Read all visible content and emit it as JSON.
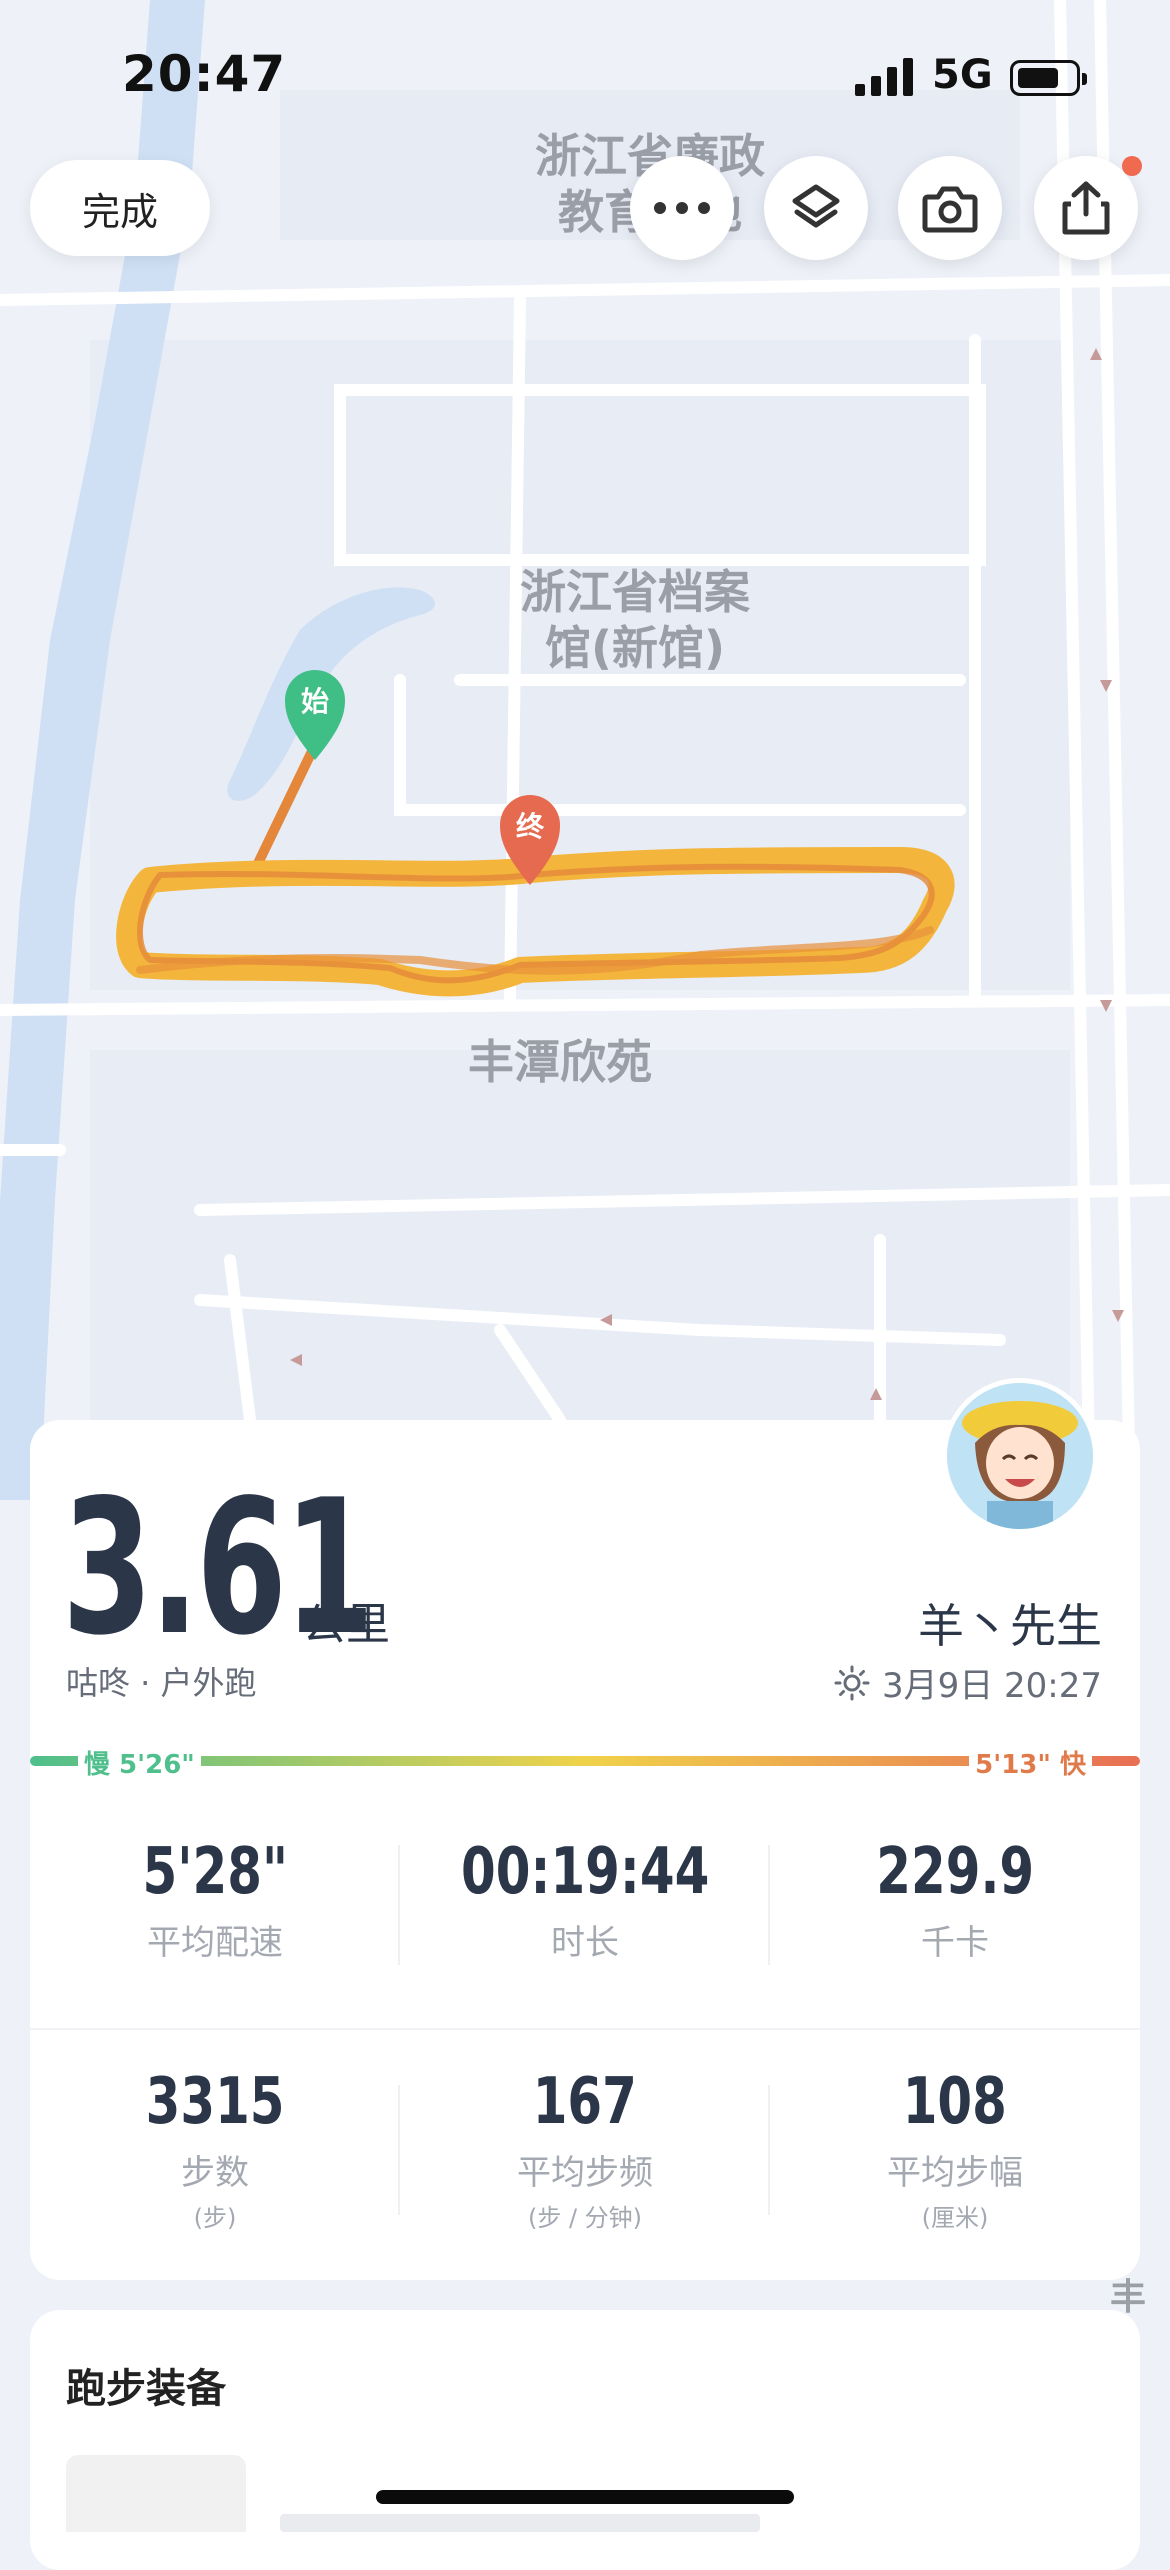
{
  "status_bar": {
    "time": "20:47",
    "network": "5G"
  },
  "top_bar": {
    "done_label": "完成"
  },
  "map": {
    "labels": [
      "浙江省廉政\n教育基地",
      "浙江省档案\n馆(新馆)",
      "丰潭欣苑"
    ],
    "edge_label": "丰",
    "start_marker": "始",
    "end_marker": "终",
    "route_color": "#f3b53b",
    "route_color_dark": "#e4873a",
    "start_color": "#3fbf86",
    "end_color": "#e66a4f"
  },
  "summary": {
    "distance": "3.61",
    "distance_unit": "公里",
    "source": "咕咚 · 户外跑",
    "user_name": "羊丶先生",
    "date_time": "3月9日 20:27",
    "weather_icon": "sun-icon"
  },
  "pace_legend": {
    "slow_label": "慢 5'26\"",
    "fast_label": "5'13\" 快",
    "slow_color": "#4fbf8c",
    "fast_color": "#e86f55"
  },
  "stats_row1": [
    {
      "value": "5'28\"",
      "label": "平均配速"
    },
    {
      "value": "00:19:44",
      "label": "时长"
    },
    {
      "value": "229.9",
      "label": "千卡"
    }
  ],
  "stats_row2": [
    {
      "value": "3315",
      "label": "步数",
      "unit": "(步)"
    },
    {
      "value": "167",
      "label": "平均步频",
      "unit": "(步 / 分钟)"
    },
    {
      "value": "108",
      "label": "平均步幅",
      "unit": "(厘米)"
    }
  ],
  "gear": {
    "title": "跑步装备"
  }
}
